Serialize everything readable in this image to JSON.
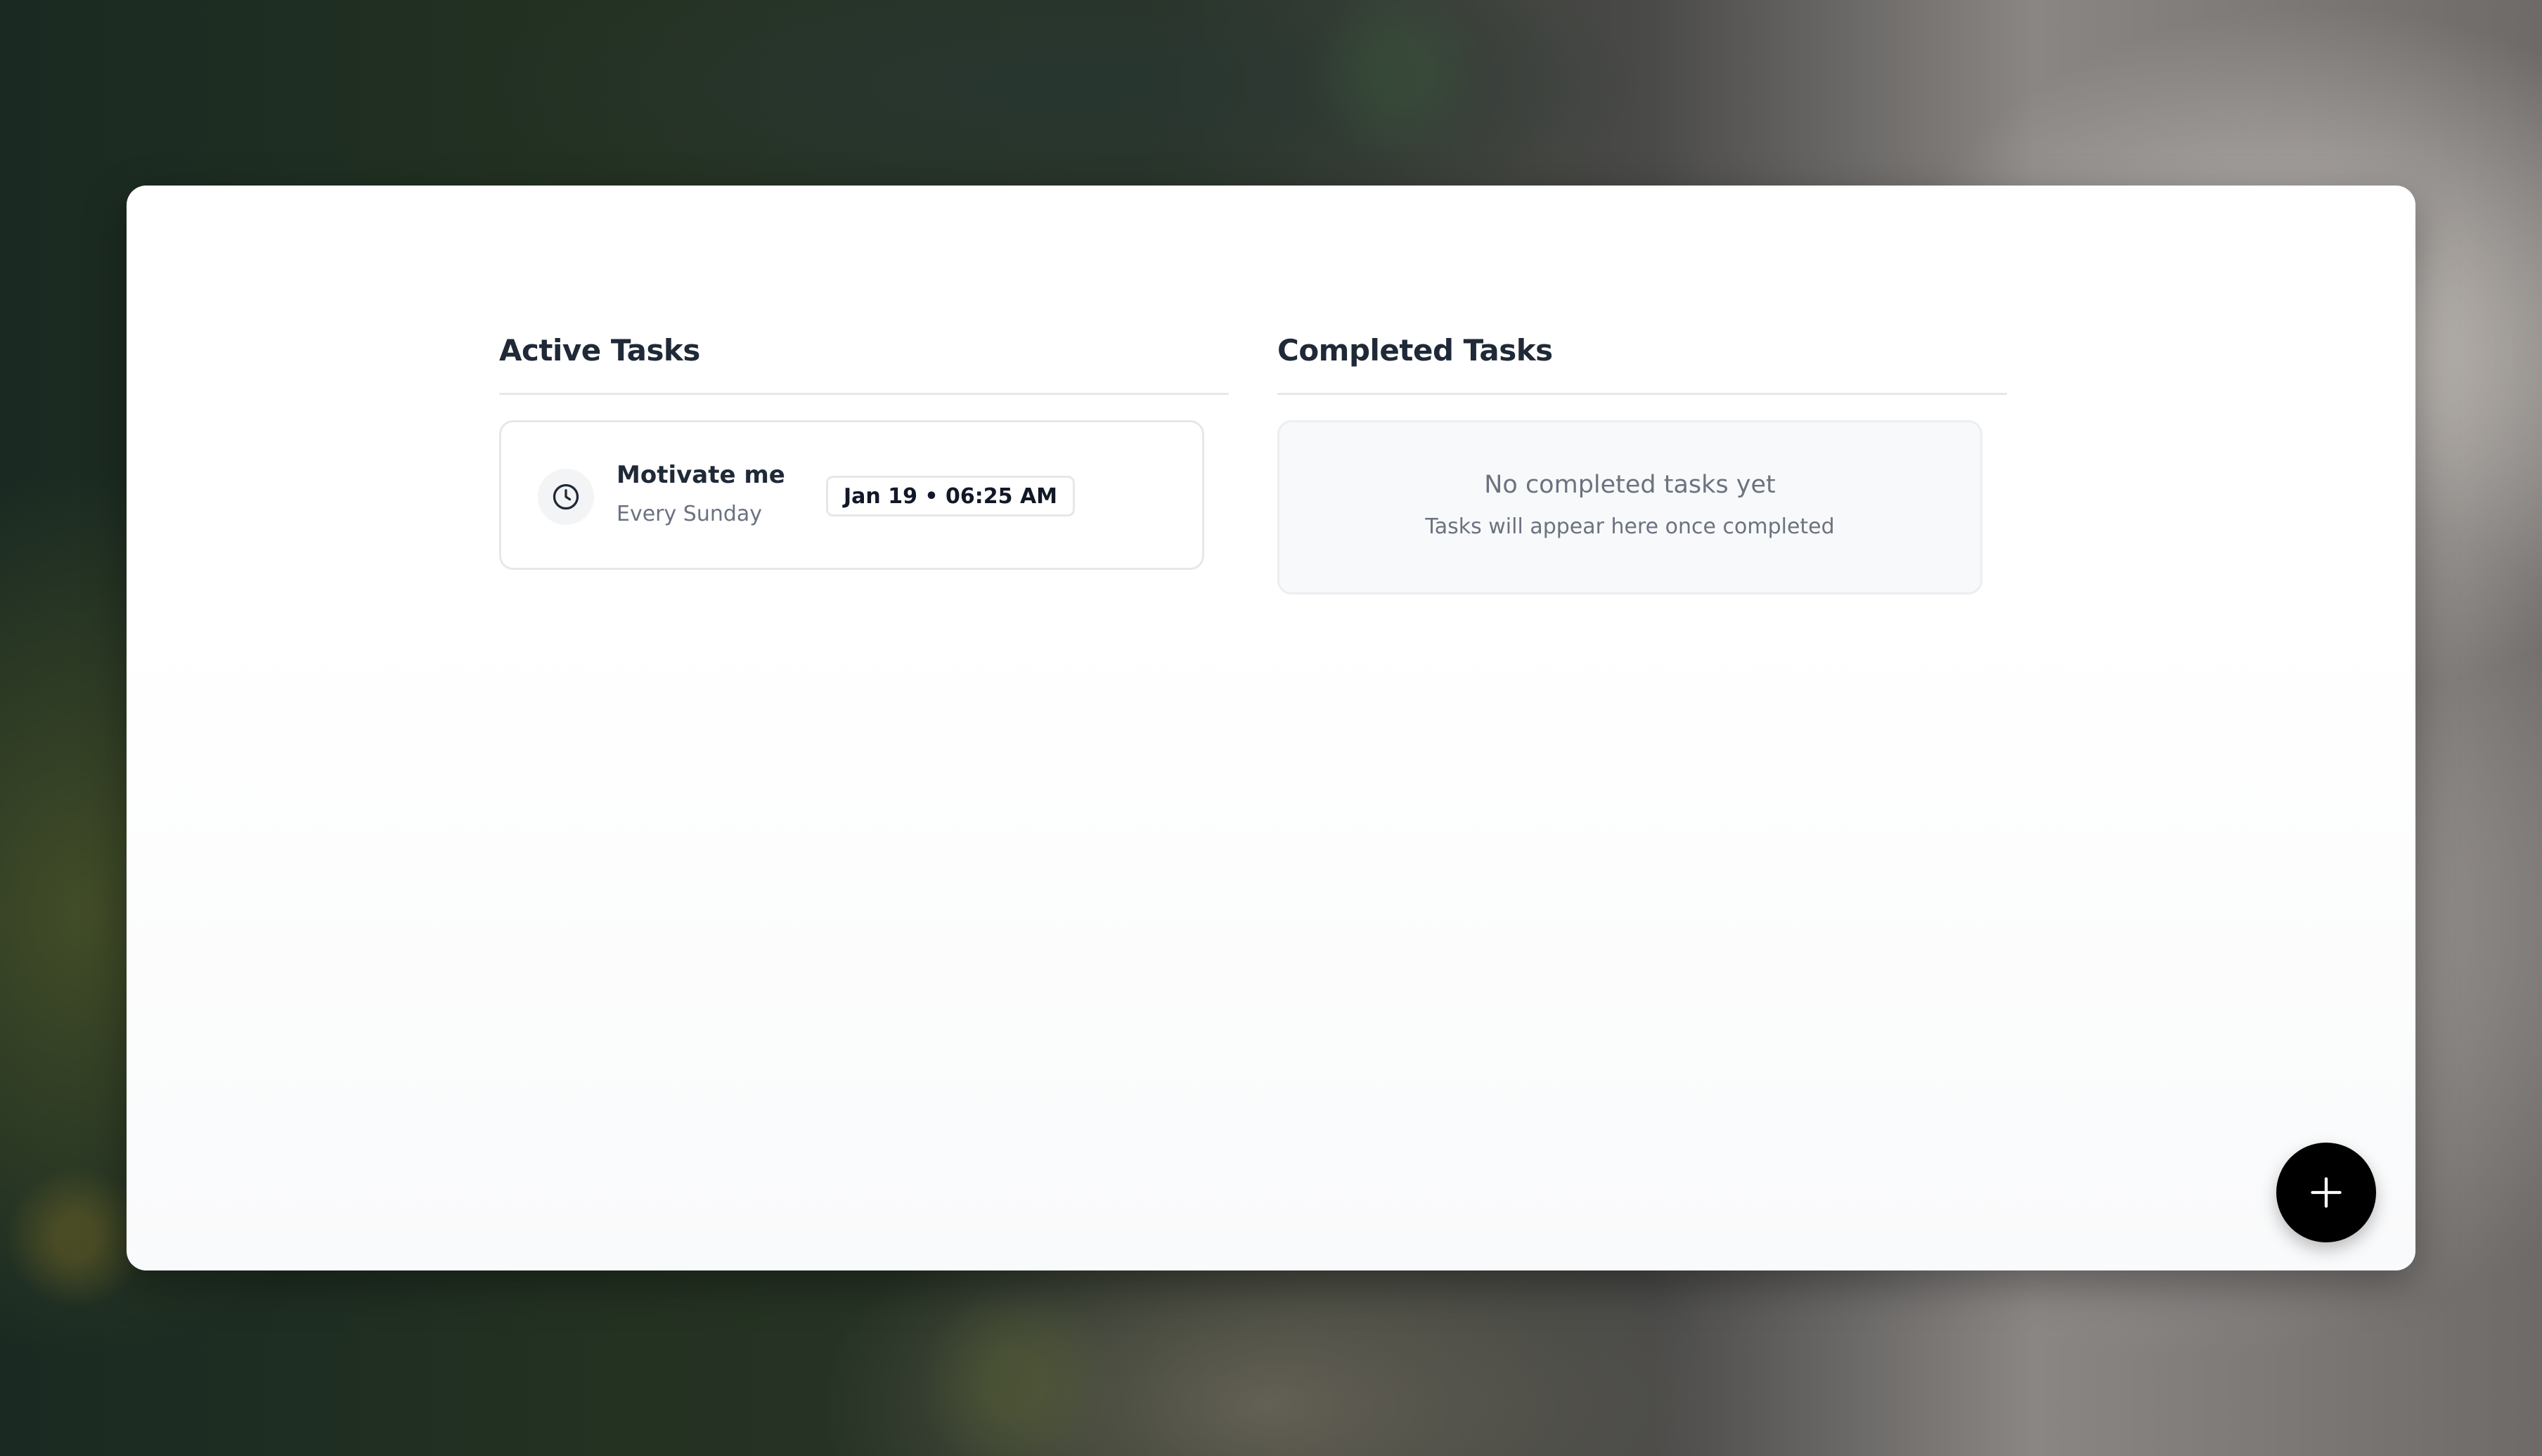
{
  "background": {
    "description_icon": "forest-fog-photo"
  },
  "active": {
    "title": "Active Tasks",
    "tasks": [
      {
        "icon": "clock-icon",
        "title": "Motivate me",
        "schedule": "Every Sunday",
        "due": "Jan 19 • 06:25 AM"
      }
    ]
  },
  "completed": {
    "title": "Completed Tasks",
    "empty_title": "No completed tasks yet",
    "empty_subtitle": "Tasks will appear here once completed"
  },
  "fab": {
    "icon": "plus-icon"
  },
  "colors": {
    "fab_bg": "#000000",
    "text_primary": "#1f2937",
    "text_muted": "#6b7280",
    "border": "#e5e7eb"
  }
}
